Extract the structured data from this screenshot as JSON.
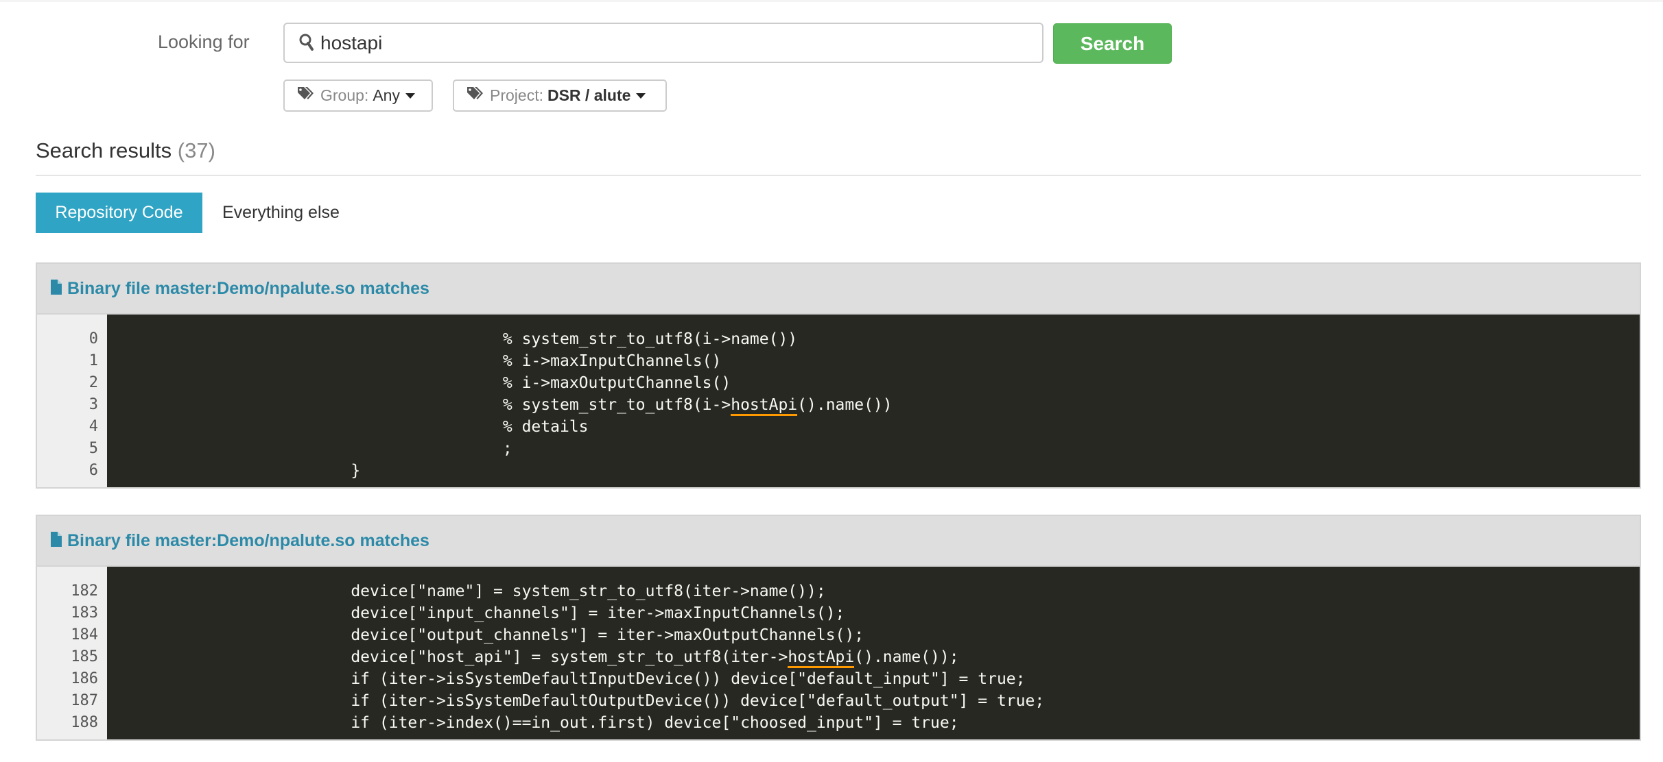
{
  "search": {
    "label": "Looking for",
    "query": "hostapi",
    "button": "Search",
    "filters": [
      {
        "name": "Group:",
        "value": "Any",
        "bold": false
      },
      {
        "name": "Project:",
        "value": "DSR / alute",
        "bold": true
      }
    ]
  },
  "results": {
    "title": "Search results",
    "count": "(37)"
  },
  "tabs": [
    {
      "label": "Repository Code",
      "active": true
    },
    {
      "label": "Everything else",
      "active": false
    }
  ],
  "colors": {
    "accent": "#2fa4c4",
    "search_button": "#5cb85c",
    "link": "#2c8aa8",
    "code_bg": "#272822",
    "match_underline": "#ff9900"
  },
  "blocks": [
    {
      "title": "Binary file master:Demo/npalute.so matches",
      "lines": [
        {
          "n": "0",
          "pre": "                                        % system_str_to_utf8(i->name())",
          "match": "",
          "post": ""
        },
        {
          "n": "1",
          "pre": "                                        % i->maxInputChannels()",
          "match": "",
          "post": ""
        },
        {
          "n": "2",
          "pre": "                                        % i->maxOutputChannels()",
          "match": "",
          "post": ""
        },
        {
          "n": "3",
          "pre": "                                        % system_str_to_utf8(i->",
          "match": "hostApi",
          "post": "().name())"
        },
        {
          "n": "4",
          "pre": "                                        % details",
          "match": "",
          "post": ""
        },
        {
          "n": "5",
          "pre": "                                        ;",
          "match": "",
          "post": ""
        },
        {
          "n": "6",
          "pre": "                        }",
          "match": "",
          "post": ""
        }
      ]
    },
    {
      "title": "Binary file master:Demo/npalute.so matches",
      "lines": [
        {
          "n": "182",
          "pre": "                        device[\"name\"] = system_str_to_utf8(iter->name());",
          "match": "",
          "post": ""
        },
        {
          "n": "183",
          "pre": "                        device[\"input_channels\"] = iter->maxInputChannels();",
          "match": "",
          "post": ""
        },
        {
          "n": "184",
          "pre": "                        device[\"output_channels\"] = iter->maxOutputChannels();",
          "match": "",
          "post": ""
        },
        {
          "n": "185",
          "pre": "                        device[\"host_api\"] = system_str_to_utf8(iter->",
          "match": "hostApi",
          "post": "().name());"
        },
        {
          "n": "186",
          "pre": "                        if (iter->isSystemDefaultInputDevice()) device[\"default_input\"] = true;",
          "match": "",
          "post": ""
        },
        {
          "n": "187",
          "pre": "                        if (iter->isSystemDefaultOutputDevice()) device[\"default_output\"] = true;",
          "match": "",
          "post": ""
        },
        {
          "n": "188",
          "pre": "                        if (iter->index()==in_out.first) device[\"choosed_input\"] = true;",
          "match": "",
          "post": ""
        }
      ]
    }
  ]
}
